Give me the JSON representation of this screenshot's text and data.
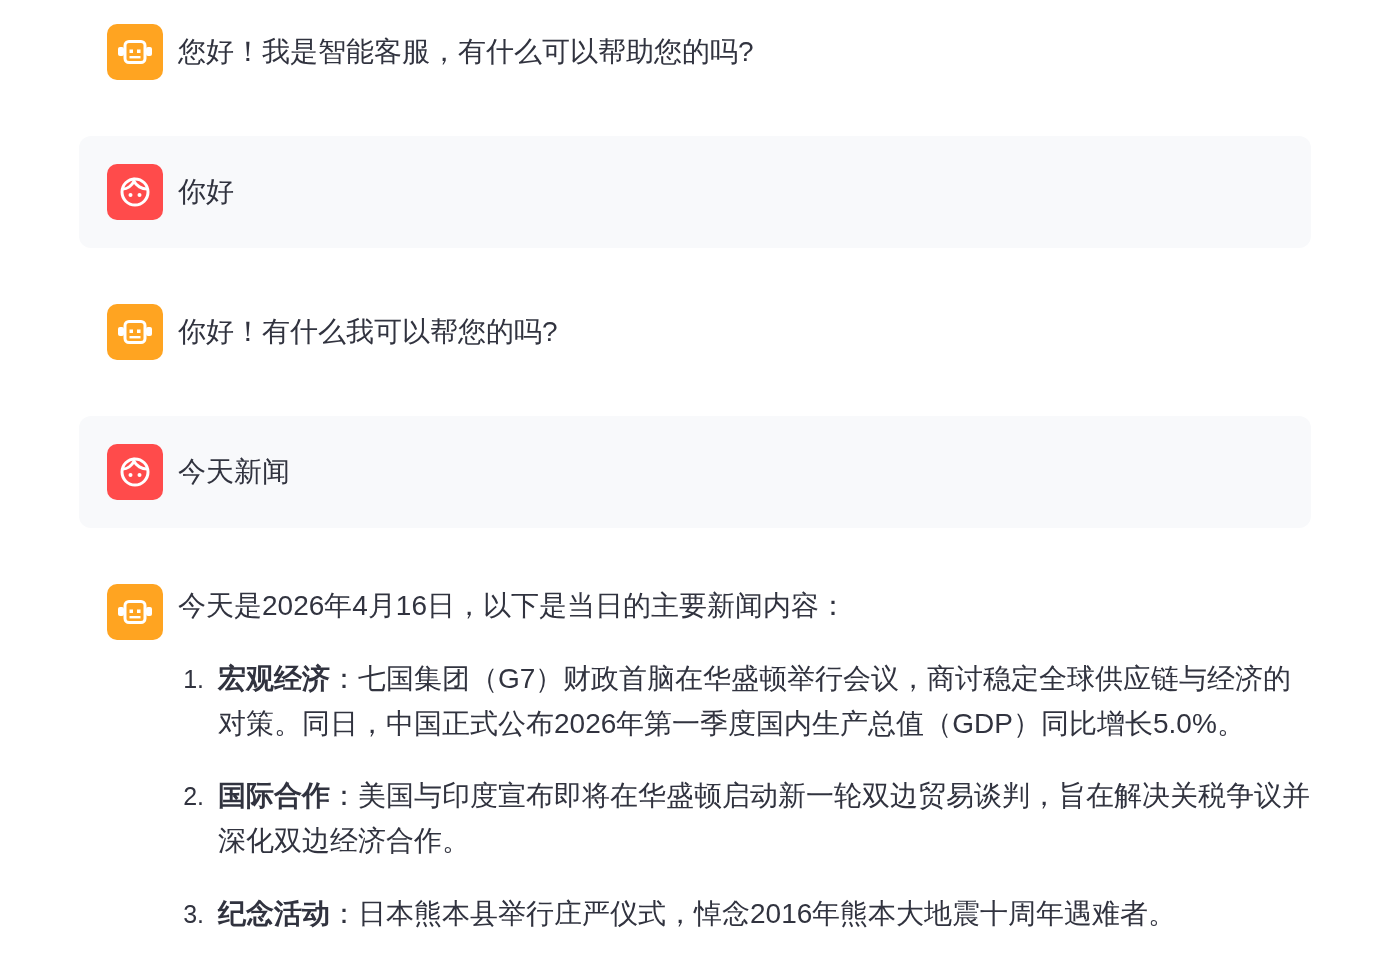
{
  "messages": [
    {
      "kind": "bot",
      "text": "您好！我是智能客服，有什么可以帮助您的吗?"
    },
    {
      "kind": "user",
      "text": "你好"
    },
    {
      "kind": "bot",
      "text": "你好！有什么我可以帮您的吗?"
    },
    {
      "kind": "user",
      "text": "今天新闻"
    },
    {
      "kind": "bot",
      "text": "今天是2026年4月16日，以下是当日的主要新闻内容：",
      "list": [
        {
          "number": "1.",
          "text": "**宏观经济**：七国集团（G7）财政首脑在华盛顿举行会议，商讨稳定全球供应链与经济的对策。同日，中国正式公布2026年第一季度国内生产总值（GDP）同比增长5.0%。"
        },
        {
          "number": "2.",
          "text": "**国际合作**：美国与印度宣布即将在华盛顿启动新一轮双边贸易谈判，旨在解决关税争议并深化双边经济合作。"
        },
        {
          "number": "3.",
          "text": "**纪念活动**：日本熊本县举行庄严仪式，悼念2016年熊本大地震十周年遇难者。"
        }
      ]
    }
  ]
}
